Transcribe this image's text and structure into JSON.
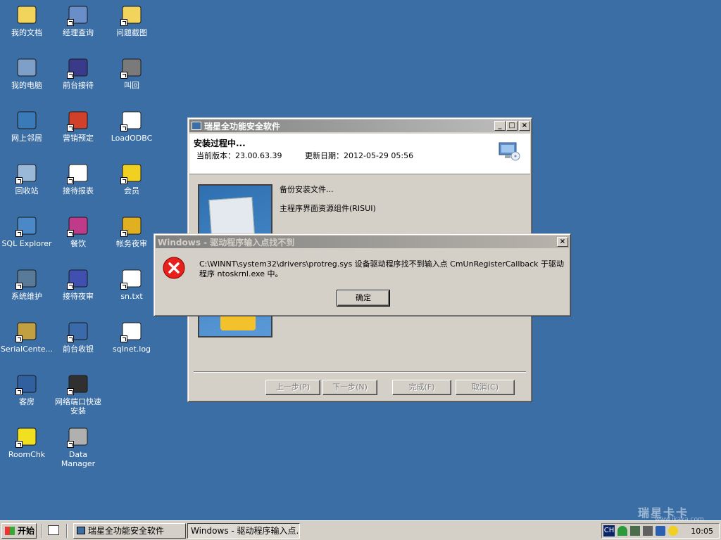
{
  "desktop_icons": [
    {
      "label": "我的文档",
      "icon": "folder-documents-icon"
    },
    {
      "label": "经理查询",
      "icon": "manager-query-icon"
    },
    {
      "label": "问题截图",
      "icon": "folder-icon"
    },
    {
      "label": "我的电脑",
      "icon": "computer-icon"
    },
    {
      "label": "前台接待",
      "icon": "reception-icon"
    },
    {
      "label": "叫回",
      "icon": "gear-icon"
    },
    {
      "label": "网上邻居",
      "icon": "network-icon"
    },
    {
      "label": "营销预定",
      "icon": "booking-icon"
    },
    {
      "label": "LoadODBC",
      "icon": "odbc-icon"
    },
    {
      "label": "回收站",
      "icon": "recycle-bin-icon"
    },
    {
      "label": "接待报表",
      "icon": "report-icon"
    },
    {
      "label": "会员",
      "icon": "member-icon"
    },
    {
      "label": "SQL Explorer",
      "icon": "sql-explorer-icon"
    },
    {
      "label": "餐饮",
      "icon": "dining-icon"
    },
    {
      "label": "帐务夜审",
      "icon": "coins-icon"
    },
    {
      "label": "系统维护",
      "icon": "maintenance-icon"
    },
    {
      "label": "接待夜审",
      "icon": "night-audit-icon"
    },
    {
      "label": "sn.txt",
      "icon": "text-file-icon"
    },
    {
      "label": "SerialCente...",
      "icon": "keys-icon"
    },
    {
      "label": "前台收银",
      "icon": "cashier-icon"
    },
    {
      "label": "sqlnet.log",
      "icon": "log-file-icon"
    },
    {
      "label": "客房",
      "icon": "house-icon"
    },
    {
      "label": "网络端口快速安装",
      "icon": "port-install-icon"
    },
    {
      "label": "",
      "icon": ""
    },
    {
      "label": "RoomChk",
      "icon": "smiley-icon"
    },
    {
      "label": "Data Manager",
      "icon": "data-manager-icon"
    }
  ],
  "installer": {
    "title": "瑞星全功能安全软件",
    "heading": "安装过程中...",
    "version_label": "当前版本：23.00.63.39",
    "date_label": "更新日期：2012-05-29 05:56",
    "status_lines": [
      "备份安装文件...",
      "主程序界面资源组件(RISUI)"
    ],
    "buttons": {
      "prev": "上一步(P)",
      "next": "下一步(N)",
      "finish": "完成(F)",
      "cancel": "取消(C)"
    }
  },
  "error_dialog": {
    "title": "Windows - 驱动程序输入点找不到",
    "message": "C:\\WINNT\\system32\\drivers\\protreg.sys 设备驱动程序找不到输入点 CmUnRegisterCallback 于驱动程序 ntoskrnl.exe 中。",
    "ok_label": "确定",
    "close_glyph": "×"
  },
  "taskbar": {
    "start_label": "开始",
    "tasks": [
      "瑞星全功能安全软件",
      "Windows - 驱动程序输入点..."
    ],
    "ime_label": "CH",
    "clock": "10:05"
  },
  "watermark": {
    "brand": "瑞星卡卡",
    "url": "www.ikaka.com"
  }
}
